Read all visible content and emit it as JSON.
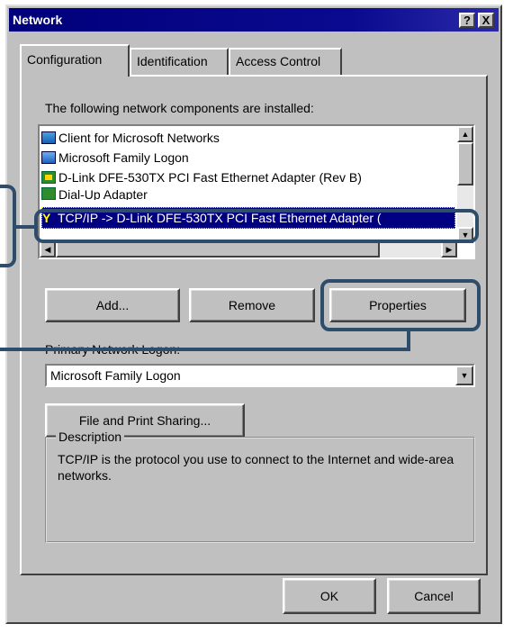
{
  "window": {
    "title": "Network",
    "help_glyph": "?",
    "close_glyph": "X"
  },
  "tabs": [
    {
      "label": "Configuration",
      "active": true
    },
    {
      "label": "Identification",
      "active": false
    },
    {
      "label": "Access Control",
      "active": false
    }
  ],
  "components": {
    "label": "The following network components are installed:",
    "items": [
      {
        "label": "Client for Microsoft Networks",
        "icon": "client-icon"
      },
      {
        "label": "Microsoft Family Logon",
        "icon": "family-logon-icon"
      },
      {
        "label": "D-Link DFE-530TX PCI Fast Ethernet Adapter (Rev B)",
        "icon": "network-adapter-icon"
      },
      {
        "label": "Dial-Up Adapter",
        "icon": "dialup-adapter-icon"
      },
      {
        "label": "TCP/IP -> D-Link DFE-530TX PCI Fast Ethernet Adapter (",
        "icon": "protocol-icon",
        "selected": true
      }
    ]
  },
  "buttons": {
    "add": "Add...",
    "remove": "Remove",
    "properties": "Properties",
    "file_print_sharing": "File and Print Sharing...",
    "ok": "OK",
    "cancel": "Cancel"
  },
  "primary_logon": {
    "label": "Primary Network Logon:",
    "value": "Microsoft Family Logon"
  },
  "description": {
    "label": "Description",
    "text": "TCP/IP is the protocol you use to connect to the Internet and wide-area networks."
  },
  "colors": {
    "title_bar": "#00007b",
    "selection": "#000080",
    "callout": "#2e4d6b",
    "face": "#c0c0c0"
  }
}
